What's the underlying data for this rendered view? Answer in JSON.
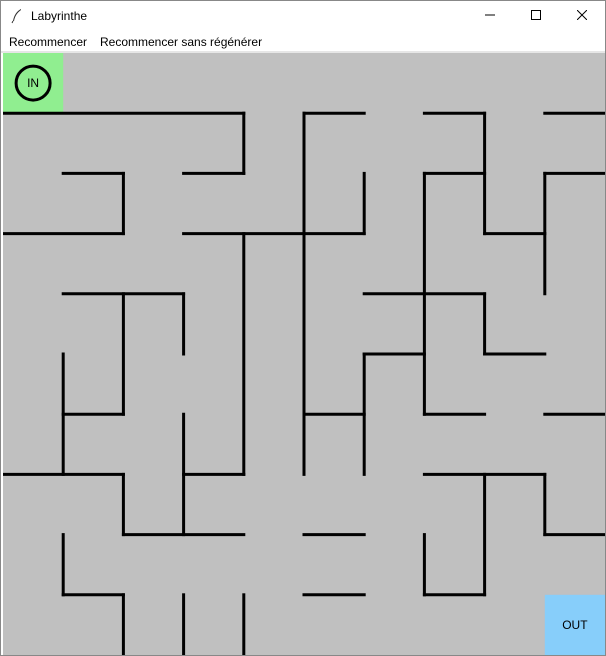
{
  "window": {
    "title": "Labyrinthe"
  },
  "icons": {
    "app": "feather-icon",
    "minimize": "minimize-icon",
    "maximize": "maximize-icon",
    "close": "close-icon"
  },
  "menu": {
    "restart": "Recommencer",
    "restart_no_regen": "Recommencer sans régénérer"
  },
  "maze": {
    "rows": 10,
    "cols": 10,
    "start": {
      "row": 0,
      "col": 0,
      "label": "IN",
      "color": "#90ee90"
    },
    "end": {
      "row": 9,
      "col": 9,
      "label": "OUT",
      "color": "#87cefa"
    },
    "background": "#c0c0c0",
    "wall_color": "#000000",
    "walls": [
      [
        [
          0,
          1
        ],
        [
          4,
          1
        ]
      ],
      [
        [
          5,
          1
        ],
        [
          6,
          1
        ]
      ],
      [
        [
          7,
          1
        ],
        [
          8,
          1
        ]
      ],
      [
        [
          9,
          1
        ],
        [
          10,
          1
        ]
      ],
      [
        [
          4,
          1
        ],
        [
          4,
          2
        ]
      ],
      [
        [
          5,
          1
        ],
        [
          5,
          7
        ]
      ],
      [
        [
          8,
          1
        ],
        [
          8,
          3
        ]
      ],
      [
        [
          1,
          2
        ],
        [
          2,
          2
        ]
      ],
      [
        [
          3,
          2
        ],
        [
          4,
          2
        ]
      ],
      [
        [
          6,
          2
        ],
        [
          6,
          3
        ]
      ],
      [
        [
          7,
          2
        ],
        [
          8,
          2
        ]
      ],
      [
        [
          9,
          2
        ],
        [
          10,
          2
        ]
      ],
      [
        [
          2,
          2
        ],
        [
          2,
          3
        ]
      ],
      [
        [
          7,
          2
        ],
        [
          7,
          6
        ]
      ],
      [
        [
          9,
          2
        ],
        [
          9,
          4
        ]
      ],
      [
        [
          0,
          3
        ],
        [
          2,
          3
        ]
      ],
      [
        [
          3,
          3
        ],
        [
          6,
          3
        ]
      ],
      [
        [
          8,
          3
        ],
        [
          9,
          3
        ]
      ],
      [
        [
          4,
          3
        ],
        [
          4,
          7
        ]
      ],
      [
        [
          1,
          4
        ],
        [
          3,
          4
        ]
      ],
      [
        [
          6,
          4
        ],
        [
          8,
          4
        ]
      ],
      [
        [
          2,
          4
        ],
        [
          2,
          6
        ]
      ],
      [
        [
          3,
          4
        ],
        [
          3,
          5
        ]
      ],
      [
        [
          1,
          5
        ],
        [
          1,
          7
        ]
      ],
      [
        [
          6,
          5
        ],
        [
          7,
          5
        ]
      ],
      [
        [
          8,
          5
        ],
        [
          9,
          5
        ]
      ],
      [
        [
          6,
          5
        ],
        [
          6,
          7
        ]
      ],
      [
        [
          8,
          4
        ],
        [
          8,
          5
        ]
      ],
      [
        [
          1,
          6
        ],
        [
          2,
          6
        ]
      ],
      [
        [
          5,
          6
        ],
        [
          6,
          6
        ]
      ],
      [
        [
          7,
          6
        ],
        [
          8,
          6
        ]
      ],
      [
        [
          9,
          6
        ],
        [
          10,
          6
        ]
      ],
      [
        [
          3,
          6
        ],
        [
          3,
          8
        ]
      ],
      [
        [
          0,
          7
        ],
        [
          2,
          7
        ]
      ],
      [
        [
          3,
          7
        ],
        [
          4,
          7
        ]
      ],
      [
        [
          7,
          7
        ],
        [
          9,
          7
        ]
      ],
      [
        [
          2,
          7
        ],
        [
          2,
          8
        ]
      ],
      [
        [
          8,
          7
        ],
        [
          8,
          9
        ]
      ],
      [
        [
          9,
          7
        ],
        [
          9,
          8
        ]
      ],
      [
        [
          2,
          8
        ],
        [
          4,
          8
        ]
      ],
      [
        [
          5,
          8
        ],
        [
          6,
          8
        ]
      ],
      [
        [
          9,
          8
        ],
        [
          10,
          8
        ]
      ],
      [
        [
          1,
          8
        ],
        [
          1,
          9
        ]
      ],
      [
        [
          7,
          8
        ],
        [
          7,
          9
        ]
      ],
      [
        [
          1,
          9
        ],
        [
          2,
          9
        ]
      ],
      [
        [
          5,
          9
        ],
        [
          6,
          9
        ]
      ],
      [
        [
          7,
          9
        ],
        [
          8,
          9
        ]
      ],
      [
        [
          2,
          9
        ],
        [
          2,
          10
        ]
      ],
      [
        [
          3,
          9
        ],
        [
          3,
          10
        ]
      ],
      [
        [
          4,
          9
        ],
        [
          4,
          10
        ]
      ]
    ]
  }
}
